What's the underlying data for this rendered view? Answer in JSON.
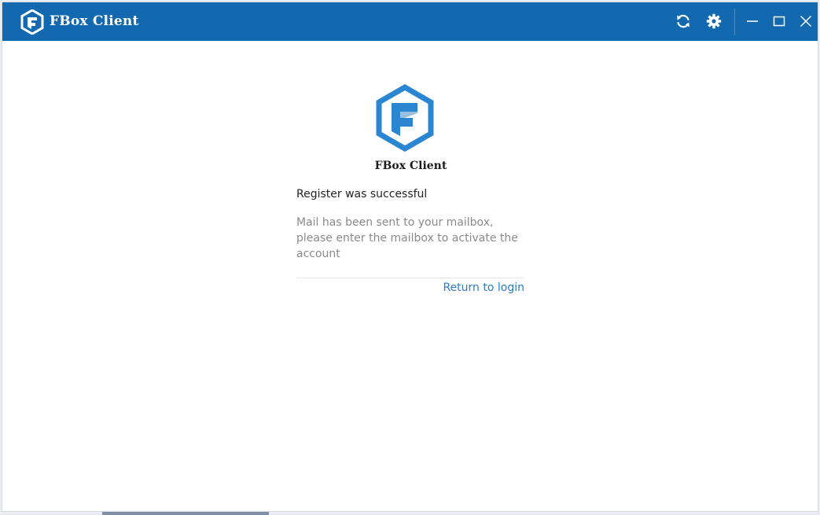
{
  "window": {
    "title": "FBox Client"
  },
  "toolbar": {
    "refresh_icon": "refresh-icon",
    "settings_icon": "gear-icon",
    "minimize_icon": "minimize-icon",
    "maximize_icon": "maximize-icon",
    "close_icon": "close-icon"
  },
  "main": {
    "app_name": "FBox Client",
    "status_title": "Register was successful",
    "status_message": "Mail has been sent to your mailbox, please enter the mailbox to activate the account",
    "return_link": "Return to login"
  },
  "colors": {
    "titlebar": "#1369b0",
    "brand": "#2b86d1",
    "link": "#2b7cc0"
  }
}
